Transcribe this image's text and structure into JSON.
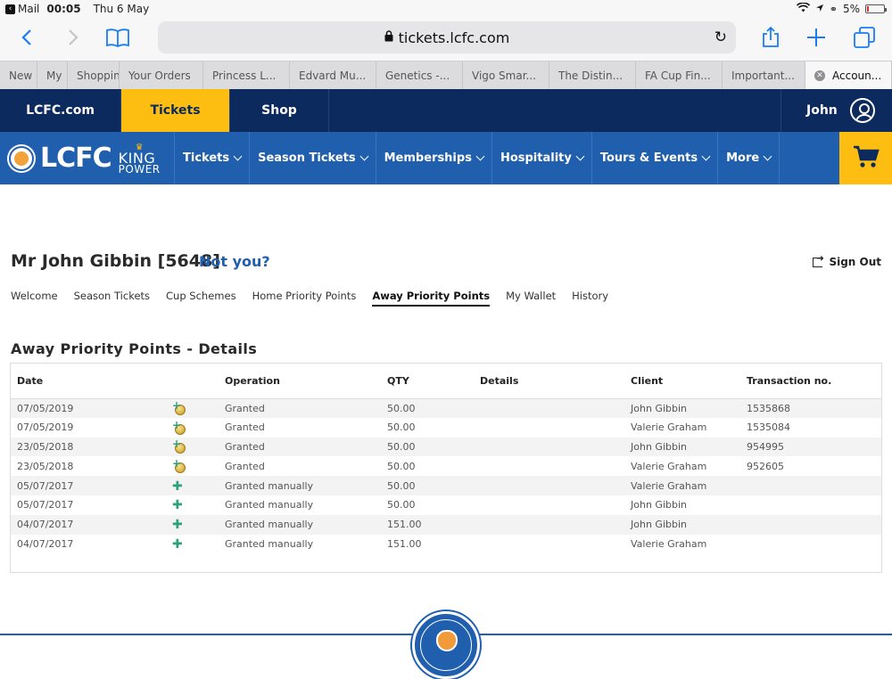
{
  "status_bar": {
    "back_app": "Mail",
    "time": "00:05",
    "date": "Thu 6 May",
    "battery": "5%",
    "battery_level": 0.05
  },
  "browser": {
    "url": "tickets.lcfc.com",
    "tabs": [
      {
        "label": "New"
      },
      {
        "label": "My"
      },
      {
        "label": "Shoppin"
      },
      {
        "label": "Your Orders"
      },
      {
        "label": "Princess L..."
      },
      {
        "label": "Edvard Mu..."
      },
      {
        "label": "Genetics -..."
      },
      {
        "label": "Vigo Smar..."
      },
      {
        "label": "The Distin..."
      },
      {
        "label": "FA Cup Fin..."
      },
      {
        "label": "Important..."
      },
      {
        "label": "Accoun..."
      }
    ]
  },
  "topnav": {
    "items": [
      "LCFC.com",
      "Tickets",
      "Shop"
    ],
    "user": "John"
  },
  "brand": {
    "name": "LCFC",
    "sponsor_line1": "KING",
    "sponsor_line2": "POWER"
  },
  "mainnav": {
    "items": [
      "Tickets",
      "Season Tickets",
      "Memberships",
      "Hospitality",
      "Tours & Events",
      "More"
    ]
  },
  "account": {
    "title": "Mr John Gibbin [5648]",
    "not_you": "Not you?",
    "sign_out": "Sign Out",
    "tabs": [
      "Welcome",
      "Season Tickets",
      "Cup Schemes",
      "Home Priority Points",
      "Away Priority Points",
      "My Wallet",
      "History"
    ]
  },
  "details": {
    "title": "Away Priority Points - Details",
    "columns": [
      "Date",
      "",
      "Operation",
      "QTY",
      "Details",
      "Client",
      "Transaction no."
    ],
    "rows": [
      {
        "date": "07/05/2019",
        "icon": "coin-plus-icon",
        "operation": "Granted",
        "qty": "50.00",
        "details": "",
        "client": "John Gibbin",
        "transaction": "1535868"
      },
      {
        "date": "07/05/2019",
        "icon": "coin-plus-icon",
        "operation": "Granted",
        "qty": "50.00",
        "details": "",
        "client": "Valerie Graham",
        "transaction": "1535084"
      },
      {
        "date": "23/05/2018",
        "icon": "coin-plus-icon",
        "operation": "Granted",
        "qty": "50.00",
        "details": "",
        "client": "John Gibbin",
        "transaction": "954995"
      },
      {
        "date": "23/05/2018",
        "icon": "coin-plus-icon",
        "operation": "Granted",
        "qty": "50.00",
        "details": "",
        "client": "Valerie Graham",
        "transaction": "952605"
      },
      {
        "date": "05/07/2017",
        "icon": "plus-icon",
        "operation": "Granted manually",
        "qty": "50.00",
        "details": "",
        "client": "Valerie Graham",
        "transaction": ""
      },
      {
        "date": "05/07/2017",
        "icon": "plus-icon",
        "operation": "Granted manually",
        "qty": "50.00",
        "details": "",
        "client": "John Gibbin",
        "transaction": ""
      },
      {
        "date": "04/07/2017",
        "icon": "plus-icon",
        "operation": "Granted manually",
        "qty": "151.00",
        "details": "",
        "client": "John Gibbin",
        "transaction": ""
      },
      {
        "date": "04/07/2017",
        "icon": "plus-icon",
        "operation": "Granted manually",
        "qty": "151.00",
        "details": "",
        "client": "Valerie Graham",
        "transaction": ""
      }
    ]
  },
  "colors": {
    "navy": "#0d2a5e",
    "blue": "#1f5fae",
    "yellow": "#fdbe11"
  }
}
